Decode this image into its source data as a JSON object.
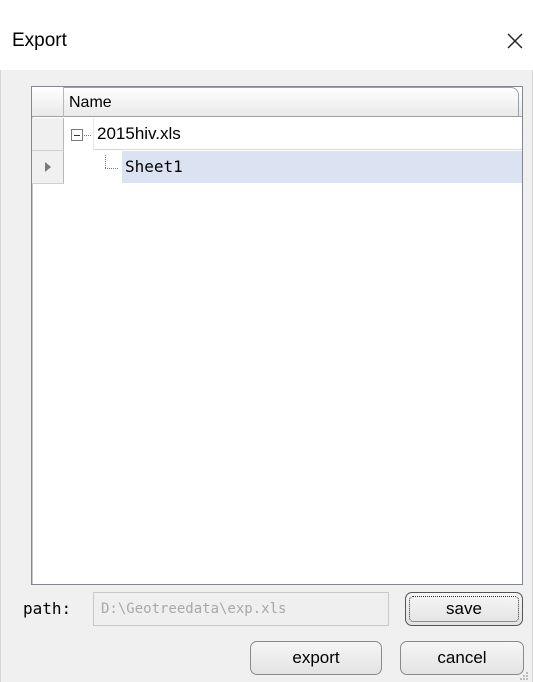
{
  "window": {
    "title": "Export",
    "close_icon": "close-icon"
  },
  "grid": {
    "column_header": "Name",
    "rows": [
      {
        "label": "2015hiv.xls",
        "expanded": true,
        "level": 0,
        "selected": false
      },
      {
        "label": "Sheet1",
        "level": 1,
        "selected": true,
        "current": true
      }
    ]
  },
  "path": {
    "label": "path:",
    "value": "D:\\Geotreedata\\exp.xls"
  },
  "buttons": {
    "save": "save",
    "export": "export",
    "cancel": "cancel"
  },
  "colors": {
    "selection": "#dbe3f3",
    "client_background": "#f0f0f0"
  }
}
